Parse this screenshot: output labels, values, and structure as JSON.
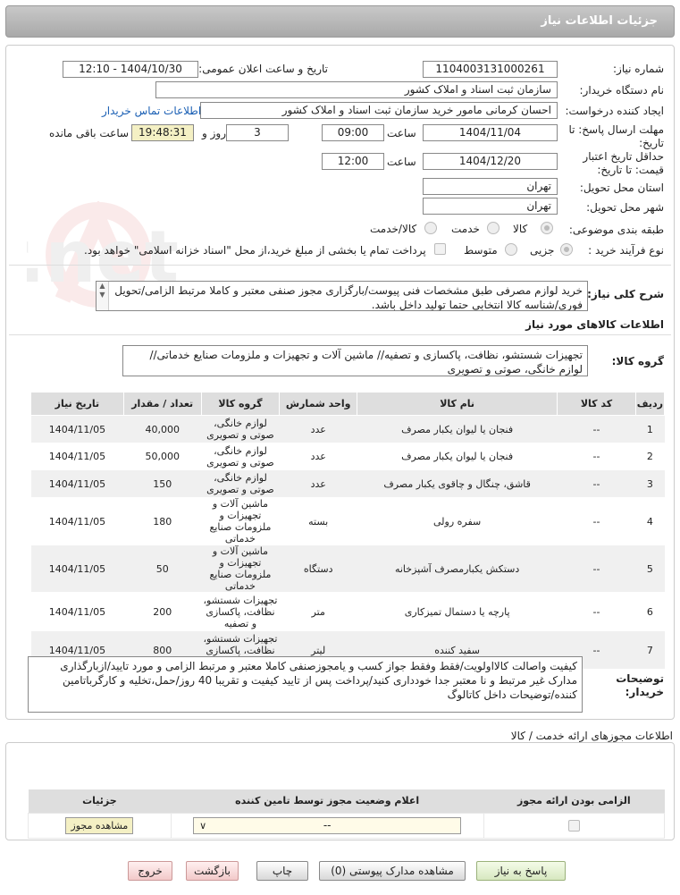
{
  "header": {
    "title": "جزئیات اطلاعات نیاز"
  },
  "form": {
    "need_number_label": "شماره نیاز:",
    "need_number": "1104003131000261",
    "announce_label": "تاریخ و ساعت اعلان عمومی:",
    "announce_value": "1404/10/30 - 12:10",
    "buyer_org_label": "نام دستگاه خریدار:",
    "buyer_org": "سازمان ثبت اسناد و املاک کشور",
    "creator_label": "ایجاد کننده درخواست:",
    "creator": "احسان کرمانی مامور خرید سازمان ثبت اسناد و املاک کشور",
    "contact_link": "اطلاعات تماس خریدار",
    "deadline_label": "مهلت ارسال پاسخ: تا تاریخ:",
    "deadline_date": "1404/11/04",
    "time_label": "ساعت",
    "deadline_time": "09:00",
    "days_value": "3",
    "days_label": "روز و",
    "remaining_time": "19:48:31",
    "remaining_label": "ساعت باقی مانده",
    "validity_label": "حداقل تاریخ اعتبار قیمت: تا تاریخ:",
    "validity_date": "1404/12/20",
    "validity_time": "12:00",
    "province_label": "استان محل تحویل:",
    "province": "تهران",
    "city_label": "شهر محل تحویل:",
    "city": "تهران",
    "category_label": "طبقه بندی موضوعی:",
    "category_options": [
      "کالا",
      "خدمت",
      "کالا/خدمت"
    ],
    "purchase_type_label": "نوع فرآیند خرید :",
    "purchase_options": [
      "جزیی",
      "متوسط"
    ],
    "payment_note": "پرداخت تمام یا بخشی از مبلغ خرید،از محل \"اسناد خزانه اسلامی\" خواهد بود.",
    "summary_label": "شرح کلی نیاز:",
    "summary": "خرید لوازم مصرفی طبق مشخصات فنی پیوست/بارگزاری مجوز صنفی معتبر و کاملا مرتبط الزامی/تحویل فوری/شناسه کالا انتخابی حتما تولید داخل باشد."
  },
  "goods": {
    "section_title": "اطلاعات کالاهای مورد نیاز",
    "group_label": "گروه کالا:",
    "group_value": "تجهیزات شستشو، نظافت، پاکسازی و تصفیه// ماشین آلات و تجهیزات و ملزومات صنایع خدماتی// لوازم خانگی، صوتی و تصویری",
    "columns": [
      "ردیف",
      "کد کالا",
      "نام کالا",
      "واحد شمارش",
      "گروه کالا",
      "تعداد / مقدار",
      "تاریخ نیاز"
    ],
    "rows": [
      {
        "idx": "1",
        "code": "--",
        "name": "فنجان یا لیوان یکبار مصرف",
        "unit": "عدد",
        "group": "لوازم خانگی، صوتی و تصویری",
        "qty": "40,000",
        "date": "1404/11/05"
      },
      {
        "idx": "2",
        "code": "--",
        "name": "فنجان یا لیوان یکبار مصرف",
        "unit": "عدد",
        "group": "لوازم خانگی، صوتی و تصویری",
        "qty": "50,000",
        "date": "1404/11/05"
      },
      {
        "idx": "3",
        "code": "--",
        "name": "قاشق، چنگال و چاقوی یکبار مصرف",
        "unit": "عدد",
        "group": "لوازم خانگی، صوتی و تصویری",
        "qty": "150",
        "date": "1404/11/05"
      },
      {
        "idx": "4",
        "code": "--",
        "name": "سفره رولی",
        "unit": "بسته",
        "group": "ماشین آلات و تجهیزات و ملزومات صنایع خدماتی",
        "qty": "180",
        "date": "1404/11/05"
      },
      {
        "idx": "5",
        "code": "--",
        "name": "دستکش یکبارمصرف آشپزخانه",
        "unit": "دستگاه",
        "group": "ماشین آلات و تجهیزات و ملزومات صنایع خدماتی",
        "qty": "50",
        "date": "1404/11/05"
      },
      {
        "idx": "6",
        "code": "--",
        "name": "پارچه یا دستمال تمیزکاری",
        "unit": "متر",
        "group": "تجهیزات شستشو، نظافت، پاکسازی و تصفیه",
        "qty": "200",
        "date": "1404/11/05"
      },
      {
        "idx": "7",
        "code": "--",
        "name": "سفید کننده",
        "unit": "لیتر",
        "group": "تجهیزات شستشو، نظافت، پاکسازی و تصفیه",
        "qty": "800",
        "date": "1404/11/05"
      }
    ]
  },
  "notes": {
    "label": "توضیحات خریدار:",
    "text": "کیفیت واصالت کالااولویت/فقط وفقط جواز کسب و یامجوزصنفی کاملا معتبر و مرتبط الزامی و مورد تایید/ازبارگذاری مدارک غیر مرتبط و نا معتبر جدا خودداری کنید/پرداخت پس از تایید کیفیت و تقریبا 40 روز/حمل،تخلیه و کارگرباتامین کننده/توضیحات داخل کاتالوگ"
  },
  "license": {
    "section_title": "اطلاعات مجوزهای ارائه خدمت / کالا",
    "columns": [
      "الزامی بودن ارائه مجوز",
      "اعلام وضعیت مجوز توسط تامین کننده",
      "جزئیات"
    ],
    "status_value": "--",
    "view_button": "مشاهده مجوز"
  },
  "buttons": {
    "reply": "پاسخ به نیاز",
    "view_docs": "مشاهده مدارک پیوستی (0)",
    "print": "چاپ",
    "back": "بازگشت",
    "exit": "خروج"
  }
}
